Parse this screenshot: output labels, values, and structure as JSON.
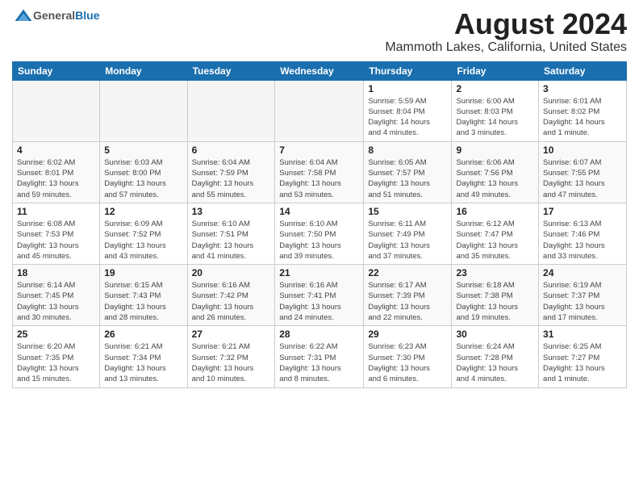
{
  "logo": {
    "general": "General",
    "blue": "Blue"
  },
  "title": "August 2024",
  "subtitle": "Mammoth Lakes, California, United States",
  "days_header": [
    "Sunday",
    "Monday",
    "Tuesday",
    "Wednesday",
    "Thursday",
    "Friday",
    "Saturday"
  ],
  "weeks": [
    [
      {
        "num": "",
        "info": "",
        "empty": true
      },
      {
        "num": "",
        "info": "",
        "empty": true
      },
      {
        "num": "",
        "info": "",
        "empty": true
      },
      {
        "num": "",
        "info": "",
        "empty": true
      },
      {
        "num": "1",
        "info": "Sunrise: 5:59 AM\nSunset: 8:04 PM\nDaylight: 14 hours\nand 4 minutes."
      },
      {
        "num": "2",
        "info": "Sunrise: 6:00 AM\nSunset: 8:03 PM\nDaylight: 14 hours\nand 3 minutes."
      },
      {
        "num": "3",
        "info": "Sunrise: 6:01 AM\nSunset: 8:02 PM\nDaylight: 14 hours\nand 1 minute."
      }
    ],
    [
      {
        "num": "4",
        "info": "Sunrise: 6:02 AM\nSunset: 8:01 PM\nDaylight: 13 hours\nand 59 minutes."
      },
      {
        "num": "5",
        "info": "Sunrise: 6:03 AM\nSunset: 8:00 PM\nDaylight: 13 hours\nand 57 minutes."
      },
      {
        "num": "6",
        "info": "Sunrise: 6:04 AM\nSunset: 7:59 PM\nDaylight: 13 hours\nand 55 minutes."
      },
      {
        "num": "7",
        "info": "Sunrise: 6:04 AM\nSunset: 7:58 PM\nDaylight: 13 hours\nand 53 minutes."
      },
      {
        "num": "8",
        "info": "Sunrise: 6:05 AM\nSunset: 7:57 PM\nDaylight: 13 hours\nand 51 minutes."
      },
      {
        "num": "9",
        "info": "Sunrise: 6:06 AM\nSunset: 7:56 PM\nDaylight: 13 hours\nand 49 minutes."
      },
      {
        "num": "10",
        "info": "Sunrise: 6:07 AM\nSunset: 7:55 PM\nDaylight: 13 hours\nand 47 minutes."
      }
    ],
    [
      {
        "num": "11",
        "info": "Sunrise: 6:08 AM\nSunset: 7:53 PM\nDaylight: 13 hours\nand 45 minutes."
      },
      {
        "num": "12",
        "info": "Sunrise: 6:09 AM\nSunset: 7:52 PM\nDaylight: 13 hours\nand 43 minutes."
      },
      {
        "num": "13",
        "info": "Sunrise: 6:10 AM\nSunset: 7:51 PM\nDaylight: 13 hours\nand 41 minutes."
      },
      {
        "num": "14",
        "info": "Sunrise: 6:10 AM\nSunset: 7:50 PM\nDaylight: 13 hours\nand 39 minutes."
      },
      {
        "num": "15",
        "info": "Sunrise: 6:11 AM\nSunset: 7:49 PM\nDaylight: 13 hours\nand 37 minutes."
      },
      {
        "num": "16",
        "info": "Sunrise: 6:12 AM\nSunset: 7:47 PM\nDaylight: 13 hours\nand 35 minutes."
      },
      {
        "num": "17",
        "info": "Sunrise: 6:13 AM\nSunset: 7:46 PM\nDaylight: 13 hours\nand 33 minutes."
      }
    ],
    [
      {
        "num": "18",
        "info": "Sunrise: 6:14 AM\nSunset: 7:45 PM\nDaylight: 13 hours\nand 30 minutes."
      },
      {
        "num": "19",
        "info": "Sunrise: 6:15 AM\nSunset: 7:43 PM\nDaylight: 13 hours\nand 28 minutes."
      },
      {
        "num": "20",
        "info": "Sunrise: 6:16 AM\nSunset: 7:42 PM\nDaylight: 13 hours\nand 26 minutes."
      },
      {
        "num": "21",
        "info": "Sunrise: 6:16 AM\nSunset: 7:41 PM\nDaylight: 13 hours\nand 24 minutes."
      },
      {
        "num": "22",
        "info": "Sunrise: 6:17 AM\nSunset: 7:39 PM\nDaylight: 13 hours\nand 22 minutes."
      },
      {
        "num": "23",
        "info": "Sunrise: 6:18 AM\nSunset: 7:38 PM\nDaylight: 13 hours\nand 19 minutes."
      },
      {
        "num": "24",
        "info": "Sunrise: 6:19 AM\nSunset: 7:37 PM\nDaylight: 13 hours\nand 17 minutes."
      }
    ],
    [
      {
        "num": "25",
        "info": "Sunrise: 6:20 AM\nSunset: 7:35 PM\nDaylight: 13 hours\nand 15 minutes."
      },
      {
        "num": "26",
        "info": "Sunrise: 6:21 AM\nSunset: 7:34 PM\nDaylight: 13 hours\nand 13 minutes."
      },
      {
        "num": "27",
        "info": "Sunrise: 6:21 AM\nSunset: 7:32 PM\nDaylight: 13 hours\nand 10 minutes."
      },
      {
        "num": "28",
        "info": "Sunrise: 6:22 AM\nSunset: 7:31 PM\nDaylight: 13 hours\nand 8 minutes."
      },
      {
        "num": "29",
        "info": "Sunrise: 6:23 AM\nSunset: 7:30 PM\nDaylight: 13 hours\nand 6 minutes."
      },
      {
        "num": "30",
        "info": "Sunrise: 6:24 AM\nSunset: 7:28 PM\nDaylight: 13 hours\nand 4 minutes."
      },
      {
        "num": "31",
        "info": "Sunrise: 6:25 AM\nSunset: 7:27 PM\nDaylight: 13 hours\nand 1 minute."
      }
    ]
  ]
}
